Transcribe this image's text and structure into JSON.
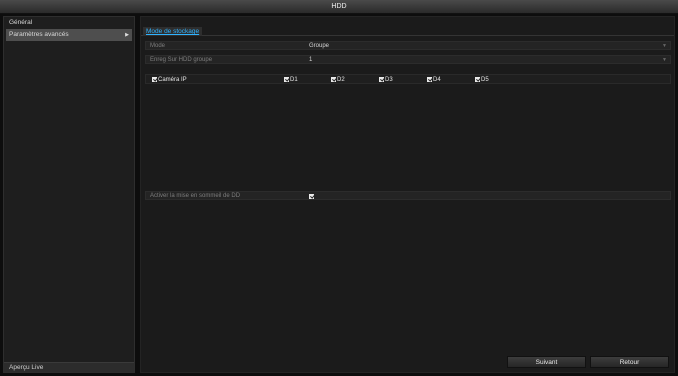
{
  "window": {
    "title": "HDD"
  },
  "sidebar": {
    "items": [
      {
        "label": "Général"
      },
      {
        "label": "Paramètres avancés"
      }
    ],
    "live_view": "Aperçu Live"
  },
  "main": {
    "tab": "Mode de stockage",
    "mode": {
      "label": "Mode",
      "value": "Groupe"
    },
    "record_group": {
      "label": "Enreg Sur HDD groupe",
      "value": "1"
    },
    "cameras": {
      "master_label": "Caméra IP",
      "items": [
        "D1",
        "D2",
        "D3",
        "D4",
        "D5"
      ]
    },
    "hdd_sleep": {
      "label": "Activer la mise en sommeil de DD",
      "checked": true
    }
  },
  "buttons": {
    "next": "Suivant",
    "back": "Retour"
  }
}
